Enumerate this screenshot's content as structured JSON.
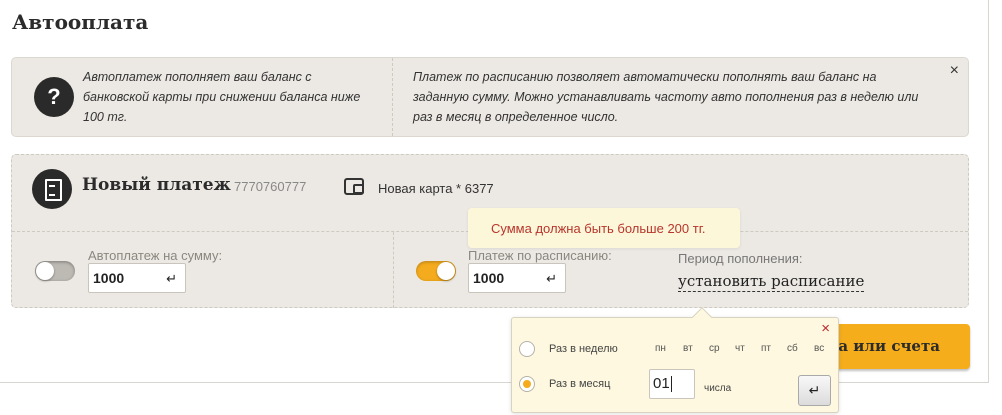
{
  "page": {
    "title": "Автооплата"
  },
  "info": {
    "autopay_text": "Автоплатеж пополняет ваш баланс с банковской карты при снижении баланса ниже 100 тг.",
    "schedule_text": "Платеж по расписанию позволяет автоматически пополнять ваш баланс на заданную сумму. Можно устанавливать частоту авто пополнения раз в неделю или раз в месяц в определенное число.",
    "close_glyph": "×",
    "question_glyph": "?"
  },
  "payment": {
    "title": "Новый платеж",
    "account": "7770760777",
    "card_label": "Новая карта * 6377",
    "autopay": {
      "label": "Автоплатеж на сумму:",
      "enabled": false,
      "amount": "1000"
    },
    "scheduled": {
      "label": "Платеж по расписанию:",
      "enabled": true,
      "amount": "1000"
    },
    "period_label": "Период пополнения:",
    "schedule_link": "установить расписание"
  },
  "tooltip": {
    "message": "Сумма должна быть больше 200 тг."
  },
  "top_up_button": {
    "label": "Пополнить с баланса или счета"
  },
  "schedule_popup": {
    "weekly_label": "Раз в неделю",
    "monthly_label": "Раз в месяц",
    "selected": "monthly",
    "days": [
      "пн",
      "вт",
      "ср",
      "чт",
      "пт",
      "сб",
      "вс"
    ],
    "day_value": "01",
    "day_suffix": "числа",
    "close_glyph": "×",
    "enter_glyph": "↵"
  },
  "icons": {
    "info": "question-icon",
    "payment": "document-icon",
    "card": "wallet-icon",
    "enter": "enter-icon",
    "close": "close-icon"
  },
  "colors": {
    "accent": "#f4ab1d",
    "panel_bg": "#ece9e4",
    "error": "#b8352c",
    "popup_bg": "#fdf8df"
  }
}
